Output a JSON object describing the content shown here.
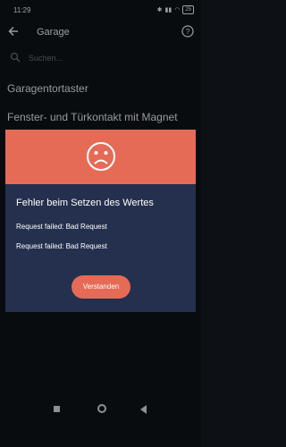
{
  "status": {
    "time": "11:29",
    "battery": "25"
  },
  "appbar": {
    "title": "Garage"
  },
  "search": {
    "placeholder": "Suchen..."
  },
  "list": {
    "items": [
      "Garagentortaster",
      "Fenster- und Türkontakt mit Magnet"
    ]
  },
  "dialog": {
    "title": "Fehler beim Setzen des Wertes",
    "messages": [
      "Request failed: Bad Request",
      "Request failed: Bad Request"
    ],
    "button_label": "Verstanden",
    "icon": "sad-face-icon"
  },
  "colors": {
    "accent": "#e56b56",
    "dialog_bg": "#25304e",
    "page_bg": "#0d1014"
  }
}
